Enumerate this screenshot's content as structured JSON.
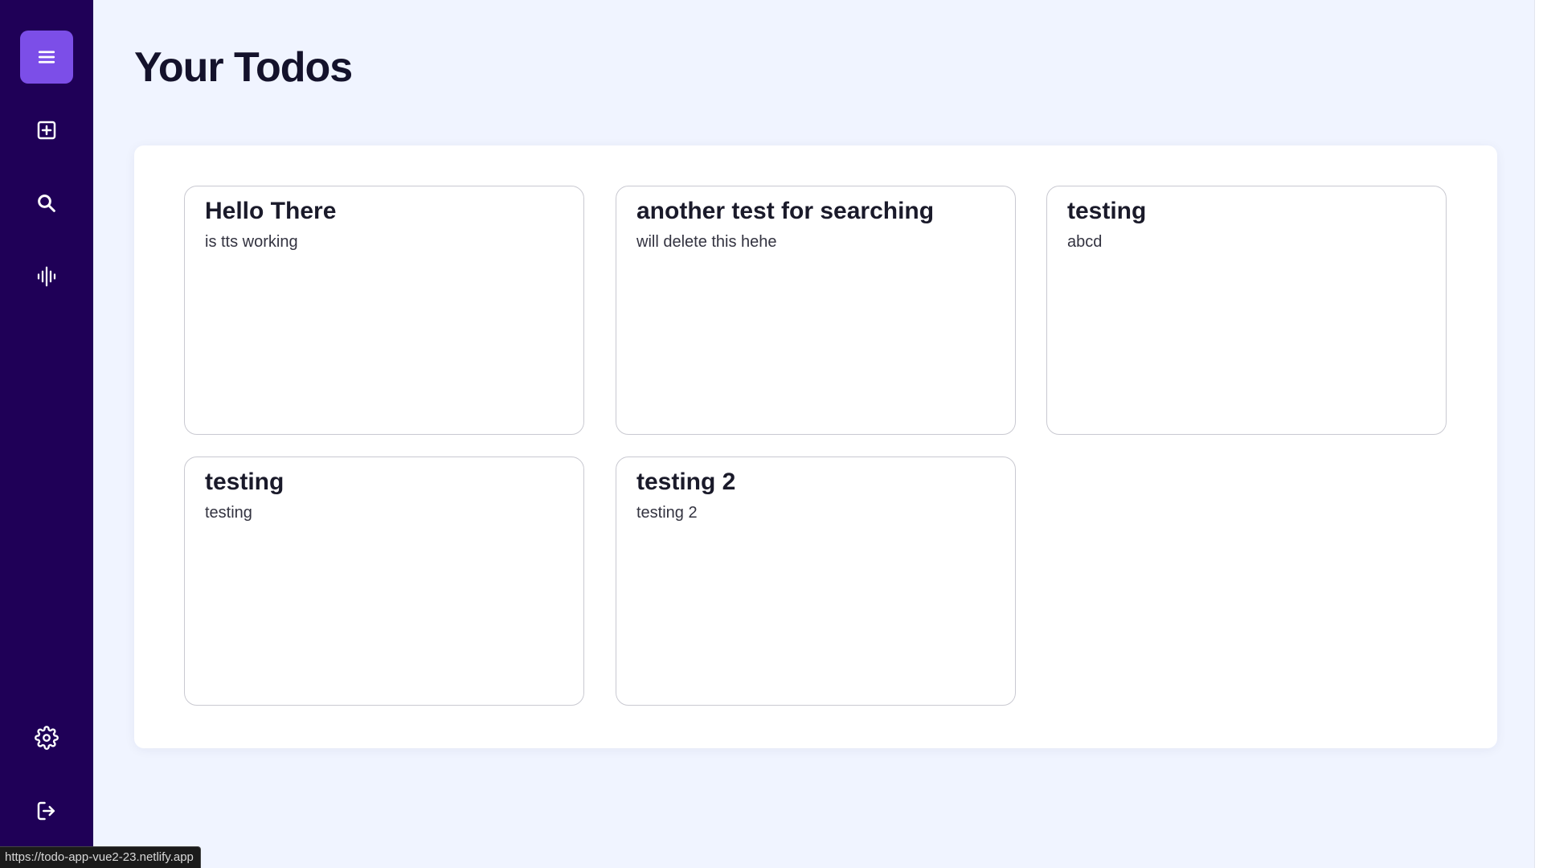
{
  "page": {
    "title": "Your Todos"
  },
  "sidebar": {
    "items": [
      {
        "name": "menu",
        "icon": "menu-icon",
        "active": true
      },
      {
        "name": "add-todo",
        "icon": "add-square-icon",
        "active": false
      },
      {
        "name": "search",
        "icon": "search-icon",
        "active": false
      },
      {
        "name": "voice",
        "icon": "audio-wave-icon",
        "active": false
      },
      {
        "name": "settings",
        "icon": "gear-icon",
        "active": false
      },
      {
        "name": "logout",
        "icon": "logout-icon",
        "active": false
      }
    ]
  },
  "todos": [
    {
      "title": "Hello There",
      "description": "is tts working"
    },
    {
      "title": "another test for searching",
      "description": "will delete this hehe"
    },
    {
      "title": "testing",
      "description": "abcd"
    },
    {
      "title": "testing",
      "description": "testing"
    },
    {
      "title": "testing 2",
      "description": "testing 2"
    }
  ],
  "status_bar": {
    "url": "https://todo-app-vue2-23.netlify.app"
  },
  "colors": {
    "sidebar_bg": "#1f0057",
    "accent": "#7c4ee8",
    "page_bg": "#f0f4ff",
    "card_border": "#c9c9d1"
  }
}
